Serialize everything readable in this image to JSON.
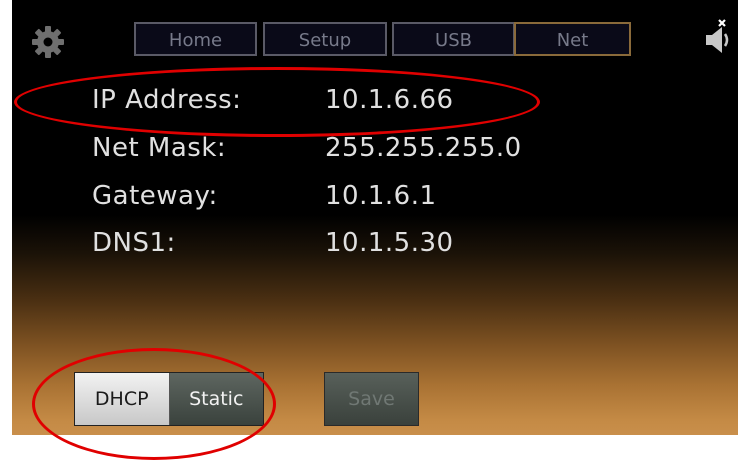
{
  "header": {
    "tabs": [
      {
        "label": "Home"
      },
      {
        "label": "Setup"
      },
      {
        "label": "USB"
      },
      {
        "label": "Net",
        "active": true
      }
    ],
    "settings_icon": "gear-icon",
    "audio_icon": "speaker-muted-icon"
  },
  "network": {
    "rows": [
      {
        "label": "IP Address:",
        "value": "10.1.6.66"
      },
      {
        "label": "Net Mask:",
        "value": "255.255.255.0"
      },
      {
        "label": "Gateway:",
        "value": "10.1.6.1"
      },
      {
        "label": "DNS1:",
        "value": "10.1.5.30"
      }
    ]
  },
  "buttons": {
    "dhcp_label": "DHCP",
    "static_label": "Static",
    "save_label": "Save",
    "selected_mode": "DHCP",
    "save_enabled": false
  },
  "colors": {
    "annotation": "#e00000",
    "tab_border": "#5a5a66",
    "active_tab_border": "#8a6a3a",
    "text": "#e0e0e0"
  }
}
